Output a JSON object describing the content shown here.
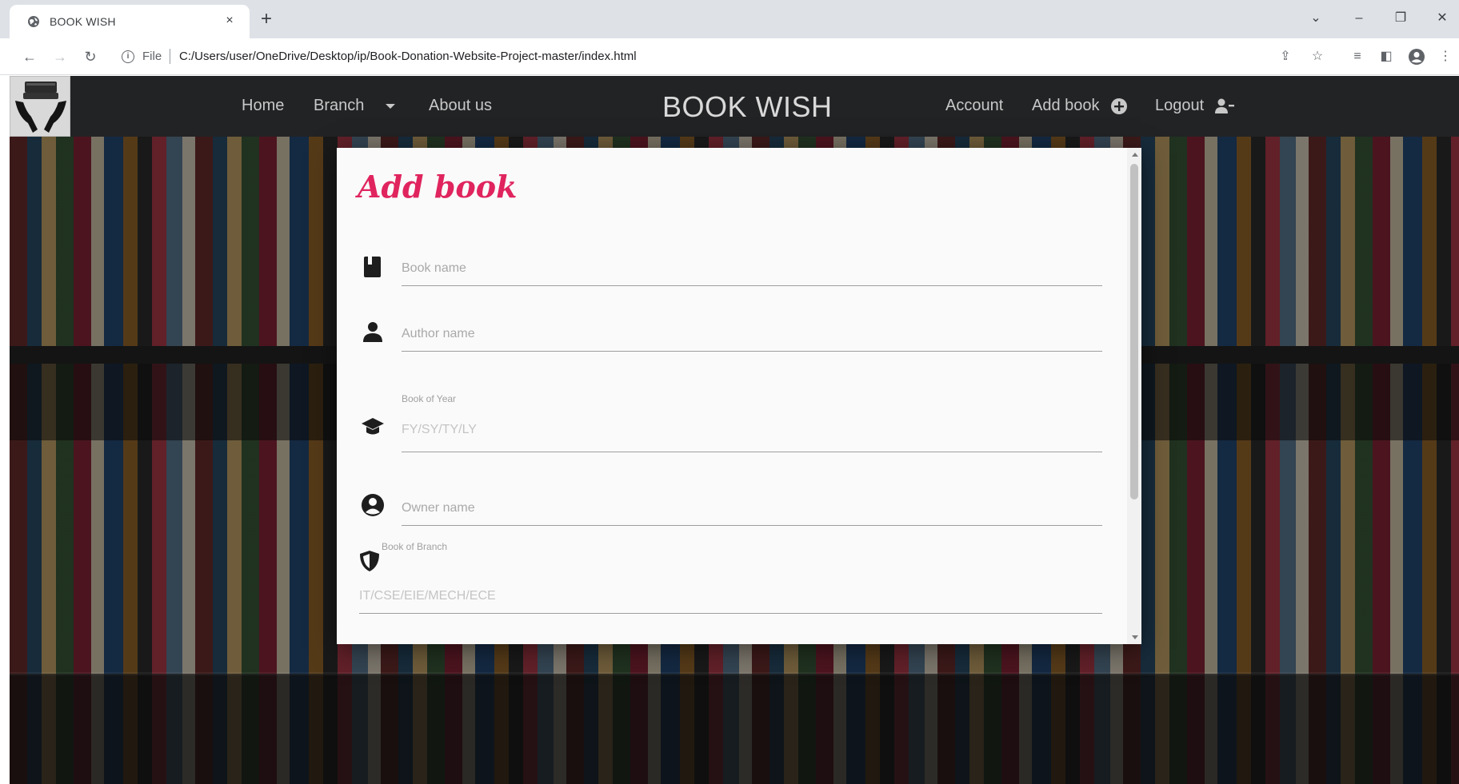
{
  "browser": {
    "tab_title": "BOOK WISH",
    "tab_close": "×",
    "new_tab": "+",
    "url_scheme": "File",
    "url": "C:/Users/user/OneDrive/Desktop/ip/Book-Donation-Website-Project-master/index.html",
    "controls": {
      "minimize": "–",
      "maximize": "❐",
      "close": "✕",
      "tab_search": "⌄"
    }
  },
  "site": {
    "brand": "BOOK WISH",
    "nav": {
      "home": "Home",
      "branch": "Branch",
      "about": "About us",
      "account": "Account",
      "add_book": "Add book",
      "logout": "Logout"
    }
  },
  "modal": {
    "title": "Add book",
    "fields": {
      "book_name": {
        "placeholder": "Book name",
        "icon": "book-icon"
      },
      "author_name": {
        "placeholder": "Author name",
        "icon": "person-icon"
      },
      "book_year": {
        "label": "Book of Year",
        "placeholder": "FY/SY/TY/LY",
        "icon": "graduation-cap-icon"
      },
      "owner_name": {
        "placeholder": "Owner name",
        "icon": "user-circle-icon"
      },
      "book_branch": {
        "label": "Book of Branch",
        "placeholder": "IT/CSE/EIE/MECH/ECE",
        "icon": "shield-icon"
      }
    }
  },
  "colors": {
    "title_accent": "#e0245e",
    "navbar_bg": "#222325",
    "modal_bg": "#fafafa"
  }
}
